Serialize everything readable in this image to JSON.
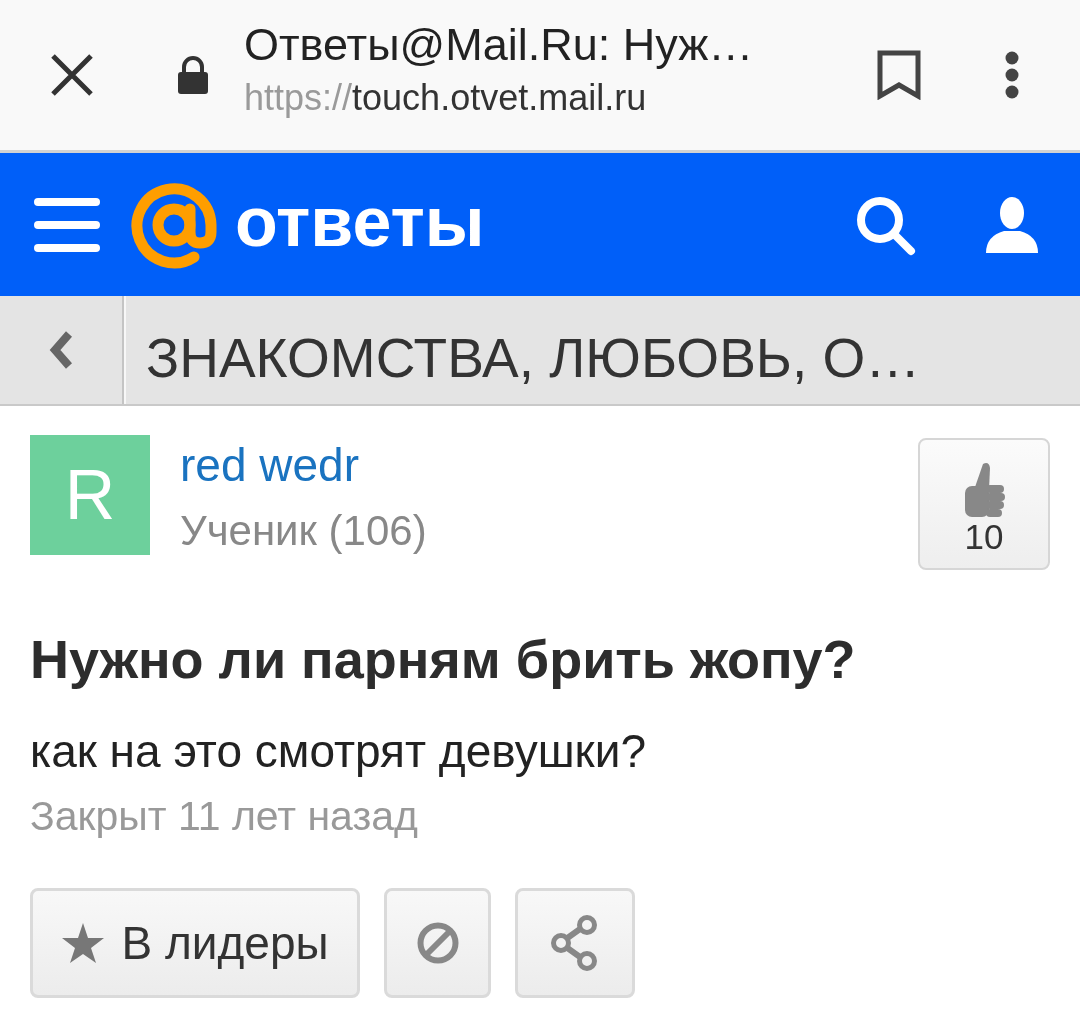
{
  "browser_bar": {
    "title": "Ответы@Mail.Ru: Нуж…",
    "url_scheme": "https://",
    "url_host": "touch.otvet.mail.ru",
    "secure": true
  },
  "header": {
    "logo_text": "ответы"
  },
  "breadcrumb": {
    "title": "ЗНАКОМСТВА, ЛЮБОВЬ, О…"
  },
  "question": {
    "author": {
      "initial": "R",
      "name": "red wedr",
      "rank": "Ученик (106)"
    },
    "likes": "10",
    "title": "Нужно ли парням брить жопу?",
    "text": "как на это смотрят девушки?",
    "status": "Закрыт 11 лет назад",
    "actions": [
      {
        "kind": "leaders",
        "label": "В лидеры"
      },
      {
        "kind": "report"
      },
      {
        "kind": "share"
      }
    ]
  }
}
